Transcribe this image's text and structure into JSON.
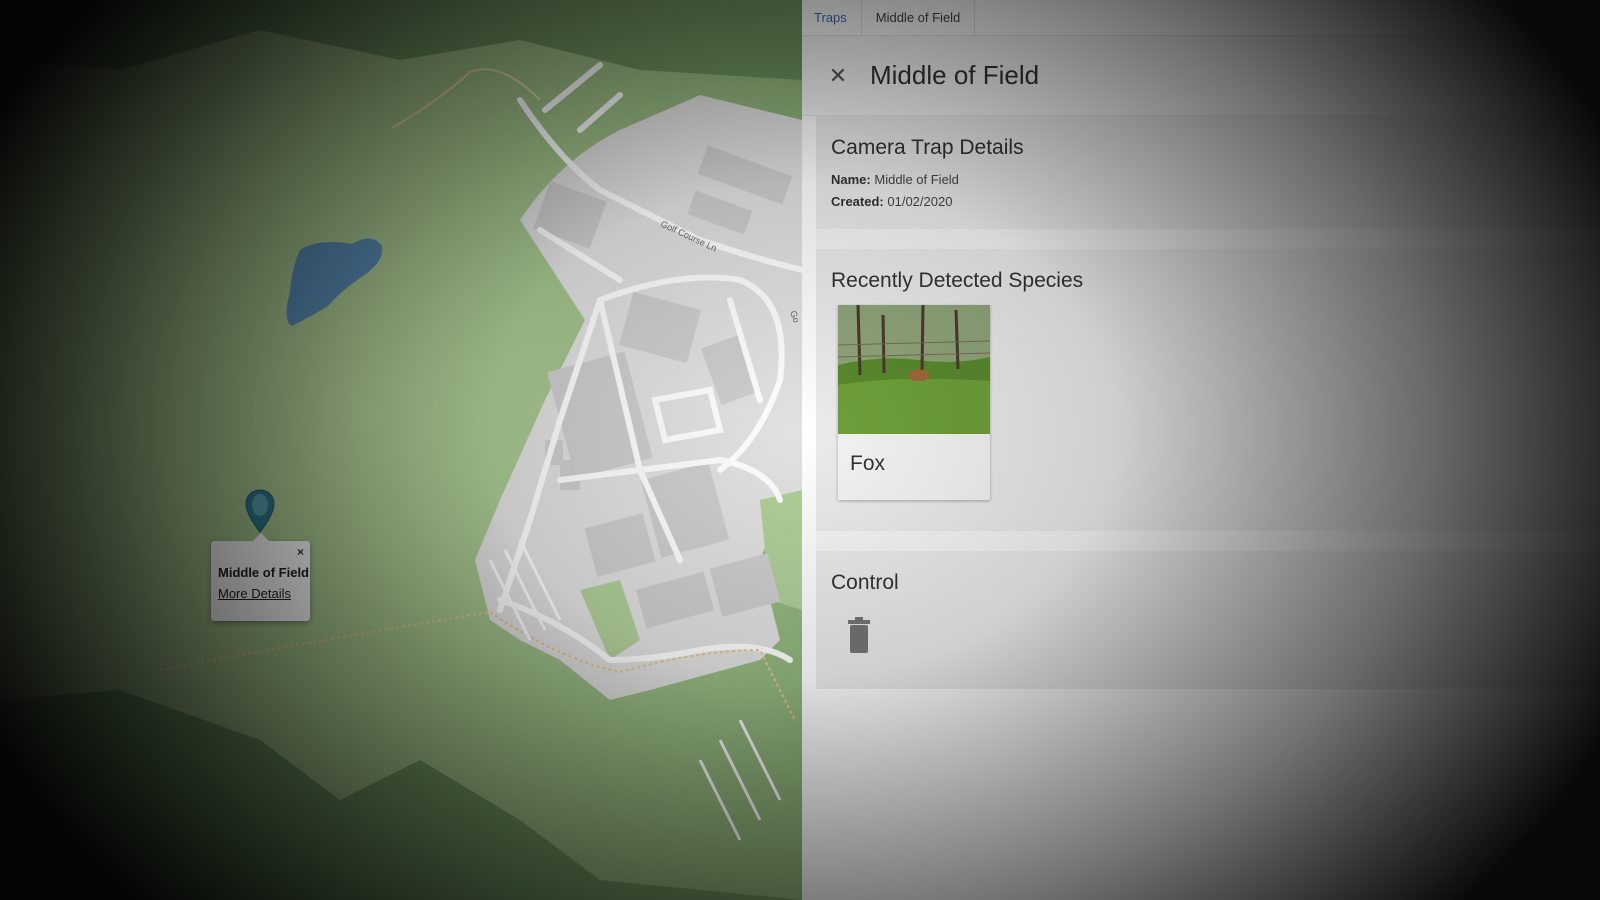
{
  "breadcrumb": {
    "items": [
      "Traps",
      "Middle of Field"
    ]
  },
  "panel": {
    "title": "Middle of Field",
    "close_icon": "close-icon"
  },
  "details": {
    "heading": "Camera Trap Details",
    "name_label": "Name:",
    "name_value": "Middle of Field",
    "created_label": "Created:",
    "created_value": "01/02/2020"
  },
  "species": {
    "heading": "Recently Detected Species",
    "items": [
      {
        "name": "Fox",
        "image": "fox-camera-photo"
      }
    ]
  },
  "control": {
    "heading": "Control",
    "delete_icon": "trash-icon"
  },
  "map": {
    "popup_title": "Middle of Field",
    "popup_link": "More Details",
    "popup_close": "×",
    "street_label_1": "Golf Course Ln",
    "street_label_2": "Go",
    "marker_icon": "map-marker-icon"
  },
  "colors": {
    "accent": "#3b6cb3",
    "map_grass": "#a8c593",
    "map_water": "#5b8fb9",
    "map_road": "#ffffff",
    "map_building": "#d9d9d9",
    "marker": "#2f7b8f"
  }
}
